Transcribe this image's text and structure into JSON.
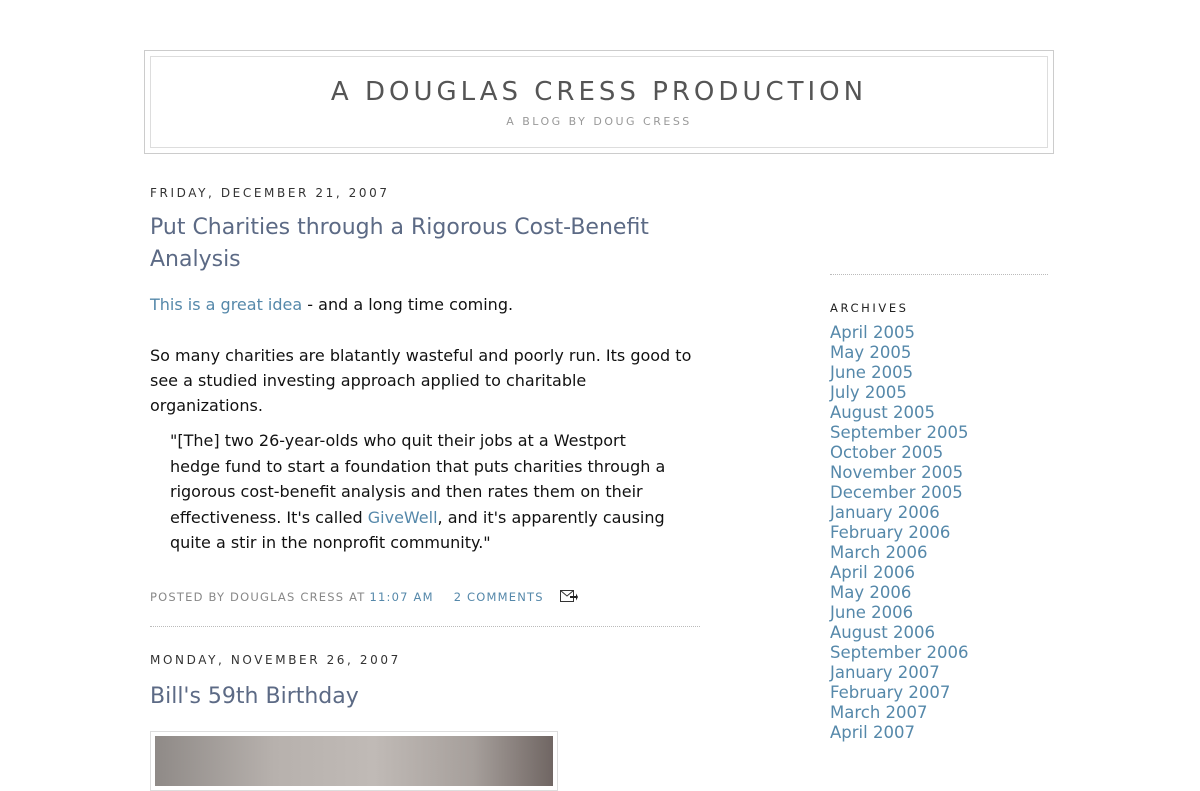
{
  "header": {
    "title": "A DOUGLAS CRESS PRODUCTION",
    "description": "A BLOG BY DOUG CRESS"
  },
  "posts": [
    {
      "date": "FRIDAY, DECEMBER 21, 2007",
      "title": "Put Charities through a Rigorous Cost-Benefit Analysis",
      "intro_link": "This is a great idea",
      "intro_rest": " - and a long time coming.",
      "paragraph": "So many charities are blatantly wasteful and poorly run. Its good to see a studied investing approach applied to charitable organizations.",
      "quote_before": "\"[The] two 26-year-olds who quit their jobs at a Westport hedge fund to start a foundation that puts charities through a rigorous cost-benefit analysis and then rates them on their effectiveness. It's called ",
      "quote_link": "GiveWell",
      "quote_after": ", and it's apparently causing quite a stir in the nonprofit community.\"",
      "footer": {
        "posted_by": "POSTED BY DOUGLAS CRESS AT",
        "time": "11:07 AM",
        "comments": "2 COMMENTS",
        "email_icon": "email-post-icon"
      }
    },
    {
      "date": "MONDAY, NOVEMBER 26, 2007",
      "title": "Bill's 59th Birthday"
    }
  ],
  "sidebar": {
    "archives_heading": "ARCHIVES",
    "archives": [
      "April 2005",
      "May 2005",
      "June 2005",
      "July 2005",
      "August 2005",
      "September 2005",
      "October 2005",
      "November 2005",
      "December 2005",
      "January 2006",
      "February 2006",
      "March 2006",
      "April 2006",
      "May 2006",
      "June 2006",
      "August 2006",
      "September 2006",
      "January 2007",
      "February 2007",
      "March 2007",
      "April 2007"
    ]
  },
  "colors": {
    "link": "#5588aa",
    "post_title": "#5c6a85",
    "header_title": "#555555"
  }
}
